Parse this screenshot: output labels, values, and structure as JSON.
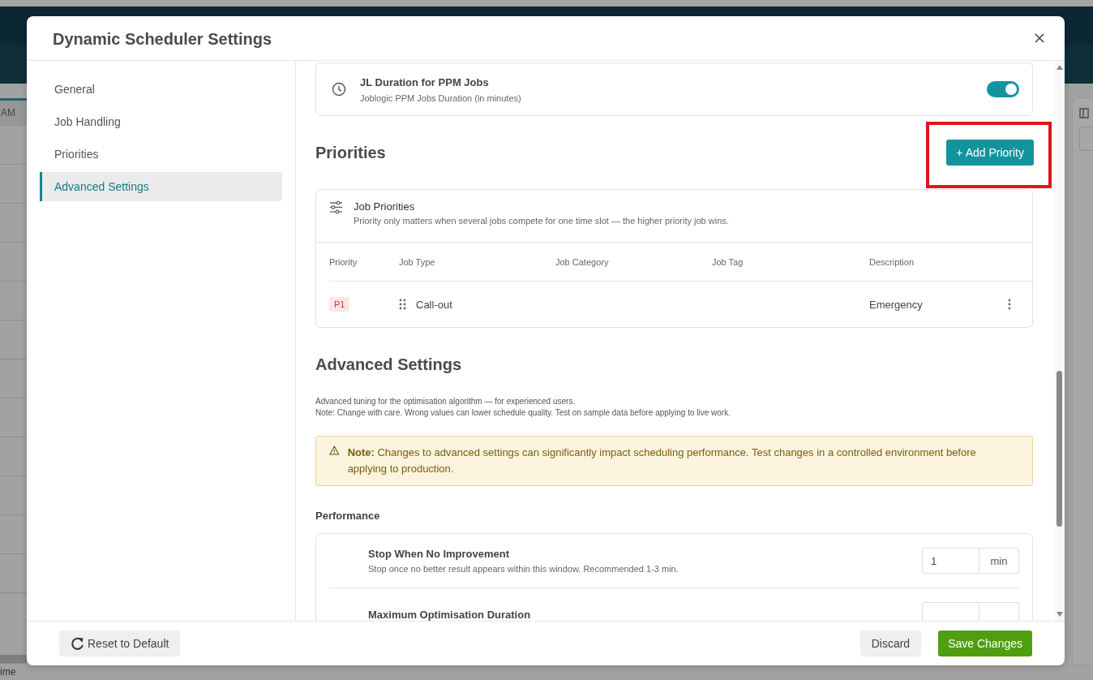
{
  "background": {
    "column_label": "AM",
    "footer_label": "ime"
  },
  "window": {
    "title": "Dynamic Scheduler Settings"
  },
  "sidebar": {
    "items": [
      {
        "label": "General",
        "selected": false
      },
      {
        "label": "Job Handling",
        "selected": false
      },
      {
        "label": "Priorities",
        "selected": false
      },
      {
        "label": "Advanced Settings",
        "selected": true
      }
    ]
  },
  "duration_card": {
    "title": "JL Duration for PPM Jobs",
    "subtitle": "Joblogic PPM Jobs Duration (in minutes)",
    "on": true
  },
  "priorities": {
    "heading": "Priorities",
    "add_button": {
      "label": "+ Add Priority",
      "highlighted": true
    },
    "table": {
      "title": "Job Priorities",
      "subtitle": "Priority only matters when several jobs compete for one time slot — the higher priority job wins.",
      "columns": [
        "Priority",
        "Job Type",
        "Job Category",
        "Job Tag",
        "Description"
      ],
      "rows": [
        {
          "priority": "P1",
          "job_type": "Call-out",
          "job_category": "",
          "job_tag": "",
          "description": "Emergency"
        }
      ]
    }
  },
  "advanced": {
    "heading": "Advanced Settings",
    "description": [
      "Advanced tuning for the optimisation algorithm — for experienced users.",
      "Note: Change with care. Wrong values can lower schedule quality. Test on sample data before applying to live work."
    ],
    "note": "**Note:** Changes to advanced settings can significantly impact scheduling performance. Test changes in a controlled environment before applying to production.",
    "section": "Performance",
    "settings": [
      {
        "title": "Stop When No Improvement",
        "subtitle": "Stop once no better result appears within this window. Recommended 1-3 min.",
        "value": "1",
        "unit": "min"
      },
      {
        "title": "Maximum Optimisation Duration"
      }
    ]
  },
  "footer": {
    "reset": "Reset to Default",
    "discard": "Discard",
    "save": "Save Changes"
  }
}
